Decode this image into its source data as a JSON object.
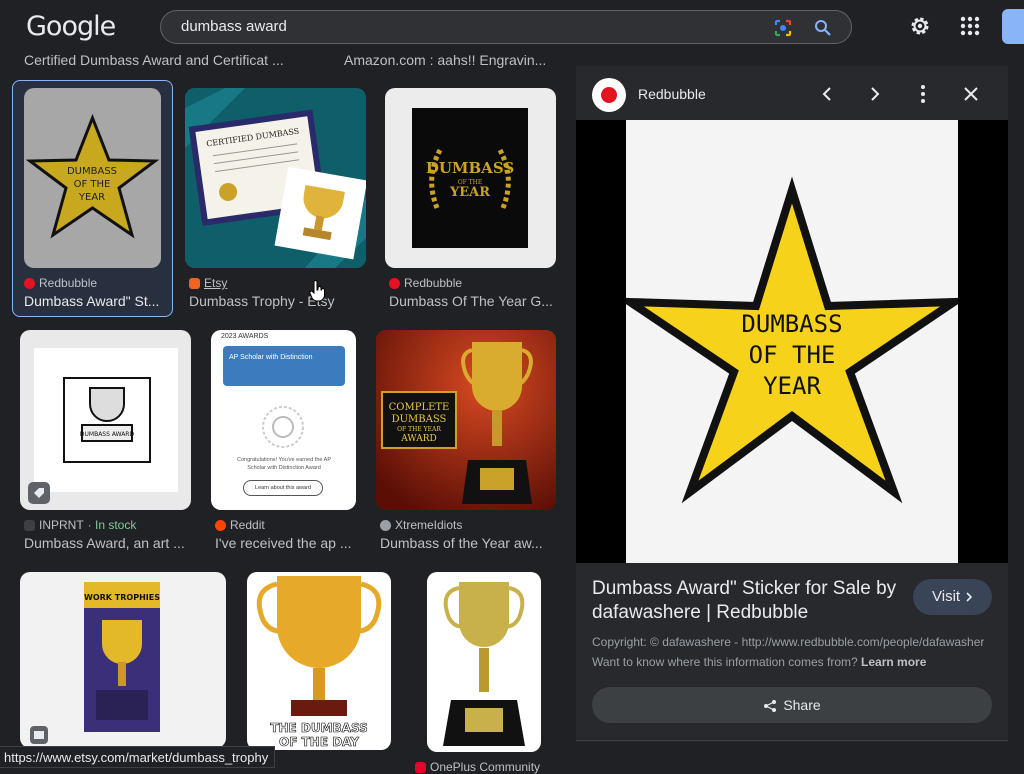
{
  "header": {
    "logo": "Google",
    "query": "dumbass award"
  },
  "top_captions": [
    "Certified Dumbass Award and Certificat ...",
    "Amazon.com : aahs!! Engravin..."
  ],
  "results": [
    {
      "source": "Redbubble",
      "title": "Dumbass Award\" St..."
    },
    {
      "source": "Etsy",
      "title": "Dumbass Trophy - Etsy"
    },
    {
      "source": "Redbubble",
      "title": "Dumbass Of The Year G..."
    },
    {
      "source": "INPRNT",
      "stock": "· In stock",
      "title": "Dumbass Award, an art ..."
    },
    {
      "source": "Reddit",
      "title": "I've received the ap ..."
    },
    {
      "source": "XtremeIdiots",
      "title": "Dumbass of the Year aw..."
    },
    {
      "source": "OnePlus Community",
      "title": ""
    }
  ],
  "thumb_text": {
    "star1": [
      "DUMBASS",
      "OF THE",
      "YEAR"
    ],
    "cert": "CERTIFIED DUMBASS",
    "laurel_top": "DUMBASS",
    "laurel_mid": "OF THE",
    "laurel_bottom": "YEAR",
    "trophy_label": "DUMBASS AWARD",
    "awards_header": "2023 AWARDS",
    "awards_card": "AP Scholar with Distinction",
    "awards_body": "Congratulations! You've earned the AP Scholar with Distinction Award",
    "awards_button": "Learn about this award",
    "complete_sign": [
      "COMPLETE",
      "DUMBASS",
      "OF THE YEAR",
      "AWARD"
    ],
    "work_trophies": "WORK TROPHIES",
    "dumbass_day": [
      "THE DUMBASS",
      "OF THE DAY"
    ]
  },
  "panel": {
    "site": "Redbubble",
    "star_text": [
      "DUMBASS",
      "OF THE",
      "YEAR"
    ],
    "title": "Dumbass Award\" Sticker for Sale by dafawashere | Redbubble",
    "visit": "Visit",
    "copyright": "Copyright: © dafawashere - http://www.redbubble.com/people/dafawasher",
    "want": "Want to know where this information comes from?",
    "learn_more": "Learn more",
    "share": "Share"
  },
  "status_bar": "https://www.etsy.com/market/dumbass_trophy",
  "colors": {
    "background": "#202124",
    "panel": "#28292c",
    "accent": "#8ab4f8",
    "star_yellow": "#f6d21a",
    "redbubble": "#e41321",
    "etsy": "#f1641e",
    "reddit": "#ff4500",
    "in_stock": "#81c995"
  }
}
